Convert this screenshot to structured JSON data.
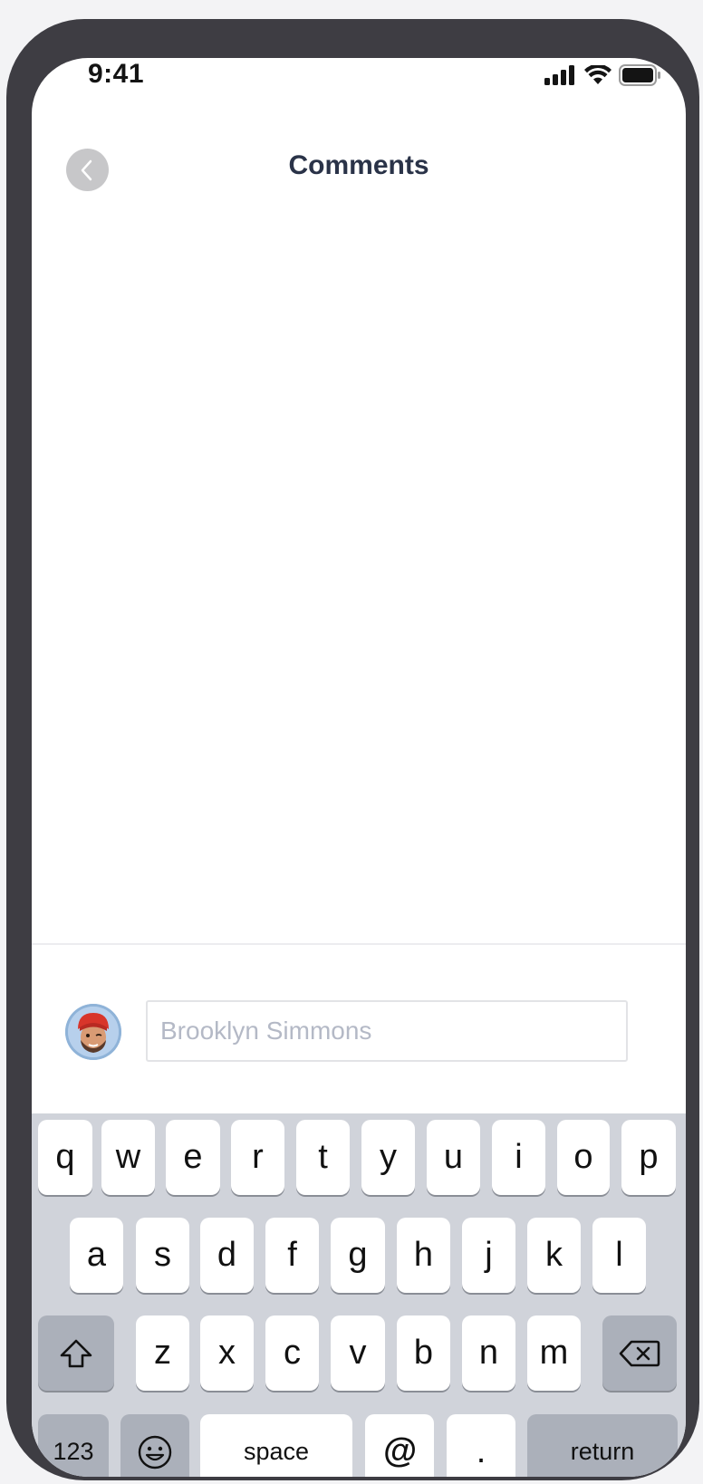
{
  "status_bar": {
    "time": "9:41"
  },
  "header": {
    "title": "Comments"
  },
  "comment_box": {
    "placeholder": "Brooklyn Simmons"
  },
  "keyboard": {
    "row1": [
      "q",
      "w",
      "e",
      "r",
      "t",
      "y",
      "u",
      "i",
      "o",
      "p"
    ],
    "row2": [
      "a",
      "s",
      "d",
      "f",
      "g",
      "h",
      "j",
      "k",
      "l"
    ],
    "row3": [
      "z",
      "x",
      "c",
      "v",
      "b",
      "n",
      "m"
    ],
    "numbers_label": "123",
    "space_label": "space",
    "at_label": "@",
    "period_label": ".",
    "return_label": "return"
  },
  "icons": {
    "back": "chevron-left-icon",
    "shift": "shift-icon",
    "delete": "backspace-icon",
    "emoji": "emoji-icon",
    "signal": "cellular-signal-icon",
    "wifi": "wifi-icon",
    "battery": "battery-icon"
  }
}
